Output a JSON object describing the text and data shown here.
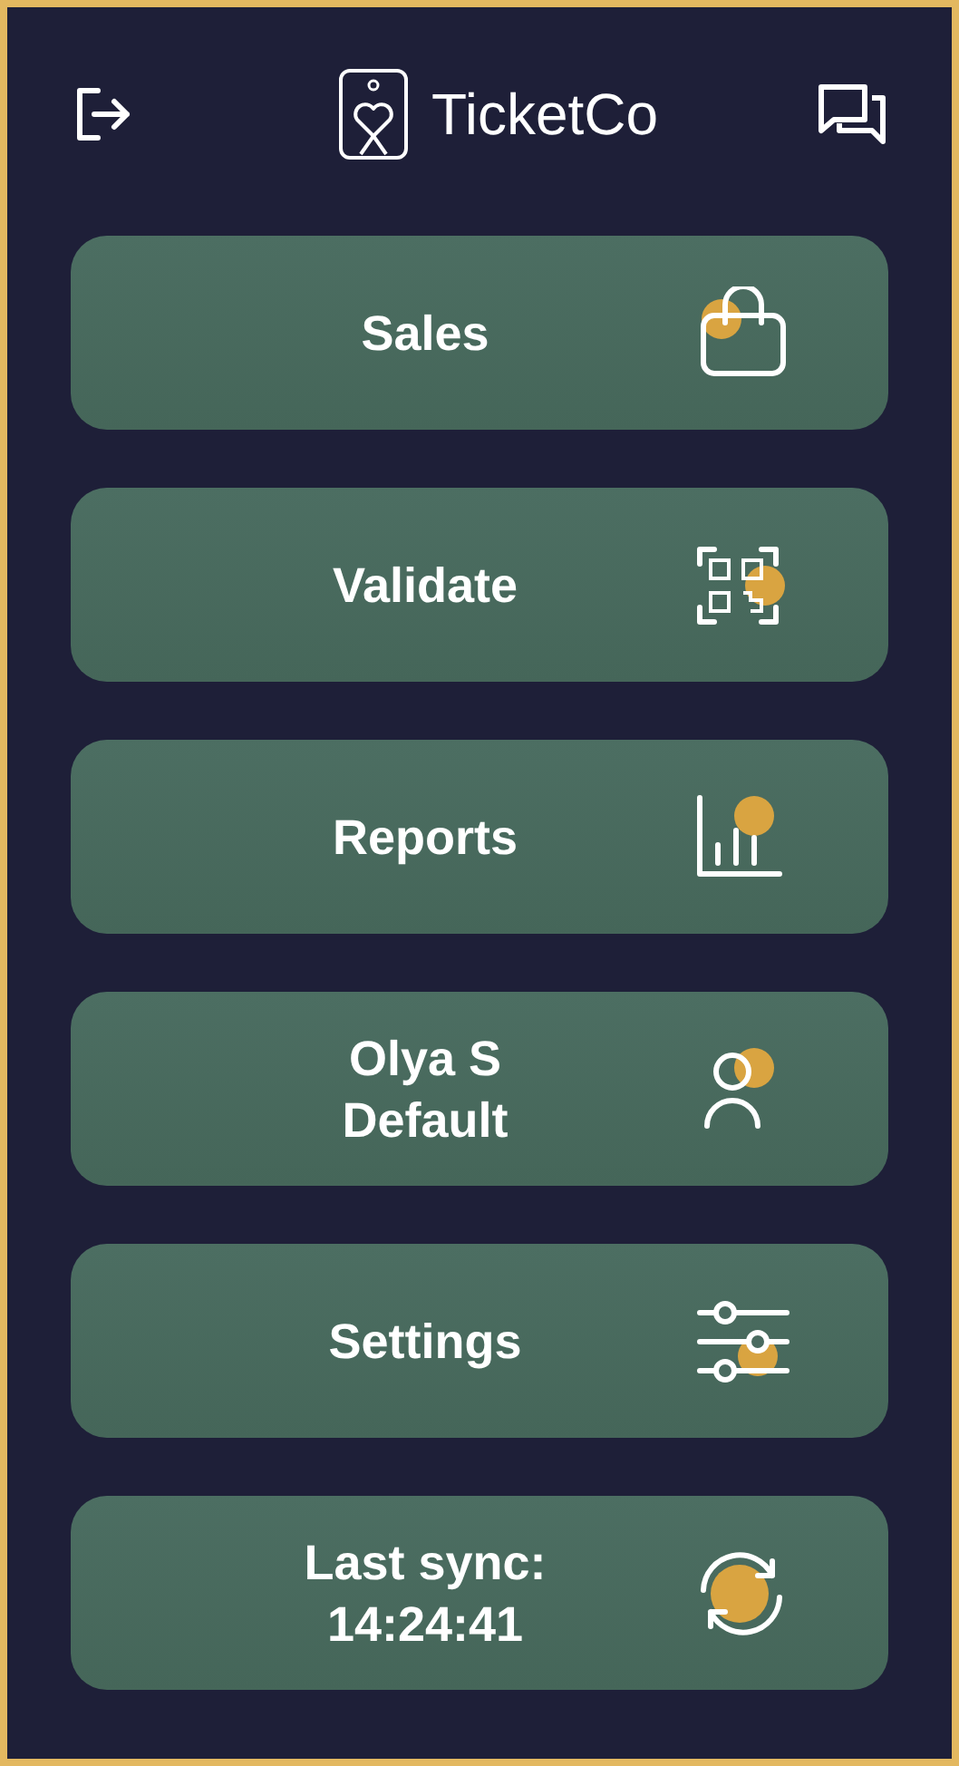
{
  "header": {
    "brand": "TicketCo"
  },
  "menu": [
    {
      "kind": "sales",
      "lines": [
        "Sales"
      ]
    },
    {
      "kind": "validate",
      "lines": [
        "Validate"
      ]
    },
    {
      "kind": "reports",
      "lines": [
        "Reports"
      ]
    },
    {
      "kind": "profile",
      "lines": [
        "Olya S",
        "Default"
      ]
    },
    {
      "kind": "settings",
      "lines": [
        "Settings"
      ]
    },
    {
      "kind": "sync",
      "lines": [
        "Last sync:",
        "14:24:41"
      ]
    }
  ]
}
